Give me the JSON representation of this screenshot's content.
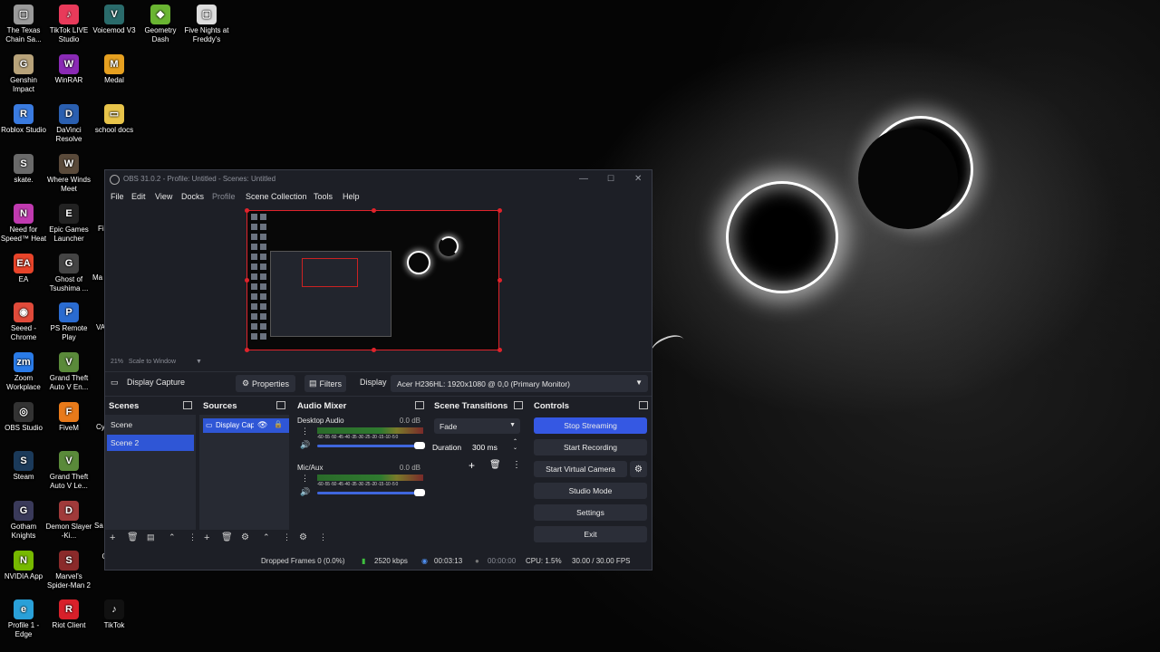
{
  "desktop": {
    "icons": [
      {
        "label": "The Texas Chain Sa...",
        "color": "#9a9a9a",
        "glyph": "▢"
      },
      {
        "label": "TikTok LIVE Studio",
        "color": "#e83a5a",
        "glyph": "♪"
      },
      {
        "label": "Voicemod V3",
        "color": "#2a6b6b",
        "glyph": "V"
      },
      {
        "label": "Geometry Dash",
        "color": "#6ab532",
        "glyph": "◆"
      },
      {
        "label": "Five Nights at Freddy's",
        "color": "#dddddd",
        "glyph": "▢"
      },
      {
        "label": "Genshin Impact",
        "color": "#b8a37a",
        "glyph": "G"
      },
      {
        "label": "WinRAR",
        "color": "#8a2ab5",
        "glyph": "W"
      },
      {
        "label": "Medal",
        "color": "#e6a020",
        "glyph": "M"
      },
      {
        "label": "Roblox Studio",
        "color": "#3a7be0",
        "glyph": "R"
      },
      {
        "label": "DaVinci Resolve",
        "color": "#2a5fb0",
        "glyph": "D"
      },
      {
        "label": "school docs",
        "color": "#e8c44a",
        "glyph": "▭"
      },
      {
        "label": "skate.",
        "color": "#6a6a6a",
        "glyph": "S"
      },
      {
        "label": "Where Winds Meet",
        "color": "#5a4a3a",
        "glyph": "W"
      },
      {
        "label": "Need for Speed™ Heat",
        "color": "#c03ab0",
        "glyph": "N"
      },
      {
        "label": "Epic Games Launcher",
        "color": "#222222",
        "glyph": "E"
      },
      {
        "label": "EA",
        "color": "#e8442a",
        "glyph": "EA"
      },
      {
        "label": "Ghost of Tsushima ...",
        "color": "#444444",
        "glyph": "G"
      },
      {
        "label": "Seeed - Chrome",
        "color": "#e04a3a",
        "glyph": "◉"
      },
      {
        "label": "PS Remote Play",
        "color": "#2a6bd0",
        "glyph": "P"
      },
      {
        "label": "Zoom Workplace",
        "color": "#2a7be8",
        "glyph": "zm"
      },
      {
        "label": "Grand Theft Auto V En...",
        "color": "#5a8a3a",
        "glyph": "V"
      },
      {
        "label": "OBS Studio",
        "color": "#333333",
        "glyph": "◎"
      },
      {
        "label": "FiveM",
        "color": "#e87a1a",
        "glyph": "F"
      },
      {
        "label": "Steam",
        "color": "#1b3a5a",
        "glyph": "S"
      },
      {
        "label": "Grand Theft Auto V Le...",
        "color": "#5a8a3a",
        "glyph": "V"
      },
      {
        "label": "Gotham Knights",
        "color": "#3a3a5a",
        "glyph": "G"
      },
      {
        "label": "Demon Slayer -Ki...",
        "color": "#a03a3a",
        "glyph": "D"
      },
      {
        "label": "NVIDIA App",
        "color": "#76b900",
        "glyph": "N"
      },
      {
        "label": "Marvel's Spider-Man 2",
        "color": "#8a2a2a",
        "glyph": "S"
      },
      {
        "label": "CapCut",
        "color": "#000000",
        "glyph": ""
      },
      {
        "label": "Profile 1 - Edge",
        "color": "#2aa0d8",
        "glyph": "e"
      },
      {
        "label": "Riot Client",
        "color": "#d8202a",
        "glyph": "R"
      },
      {
        "label": "TikTok",
        "color": "#111111",
        "glyph": "♪"
      }
    ],
    "partial_labels": [
      "Fi",
      "Ma",
      "VA",
      "Cy",
      "Sa"
    ]
  },
  "obs": {
    "title": "OBS 31.0.2 - Profile: Untitled - Scenes: Untitled",
    "menu": [
      "File",
      "Edit",
      "View",
      "Docks",
      "Profile",
      "Scene Collection",
      "Tools",
      "Help"
    ],
    "zoom": {
      "percent": "21%",
      "mode": "Scale to Window"
    },
    "source_toolbar": {
      "source_name": "Display Capture",
      "properties": "Properties",
      "filters": "Filters",
      "display_label": "Display",
      "display_value": "Acer H236HL: 1920x1080 @ 0,0 (Primary Monitor)"
    },
    "docks": {
      "scenes": {
        "title": "Scenes",
        "items": [
          "Scene",
          "Scene 2"
        ],
        "selected": 1
      },
      "sources": {
        "title": "Sources",
        "items": [
          "Display Capture"
        ]
      },
      "audio_mixer": {
        "title": "Audio Mixer",
        "tracks": [
          {
            "name": "Desktop Audio",
            "db": "0.0 dB"
          },
          {
            "name": "Mic/Aux",
            "db": "0.0 dB"
          }
        ],
        "ticks": "-60 -55 -50 -45 -40 -35 -30 -25 -20 -15 -10 -5 0"
      },
      "transitions": {
        "title": "Scene Transitions",
        "type": "Fade",
        "duration_label": "Duration",
        "duration_value": "300 ms"
      },
      "controls": {
        "title": "Controls",
        "buttons": [
          "Stop Streaming",
          "Start Recording",
          "Start Virtual Camera",
          "Studio Mode",
          "Settings",
          "Exit"
        ]
      }
    },
    "status": {
      "dropped": "Dropped Frames 0 (0.0%)",
      "bitrate": "2520 kbps",
      "stream_time": "00:03:13",
      "rec_time": "00:00:00",
      "cpu": "CPU: 1.5%",
      "fps": "30.00 / 30.00 FPS"
    },
    "colors": {
      "accent": "#3558e3",
      "selection_border": "#e0232b",
      "bg": "#1d1f26"
    }
  }
}
